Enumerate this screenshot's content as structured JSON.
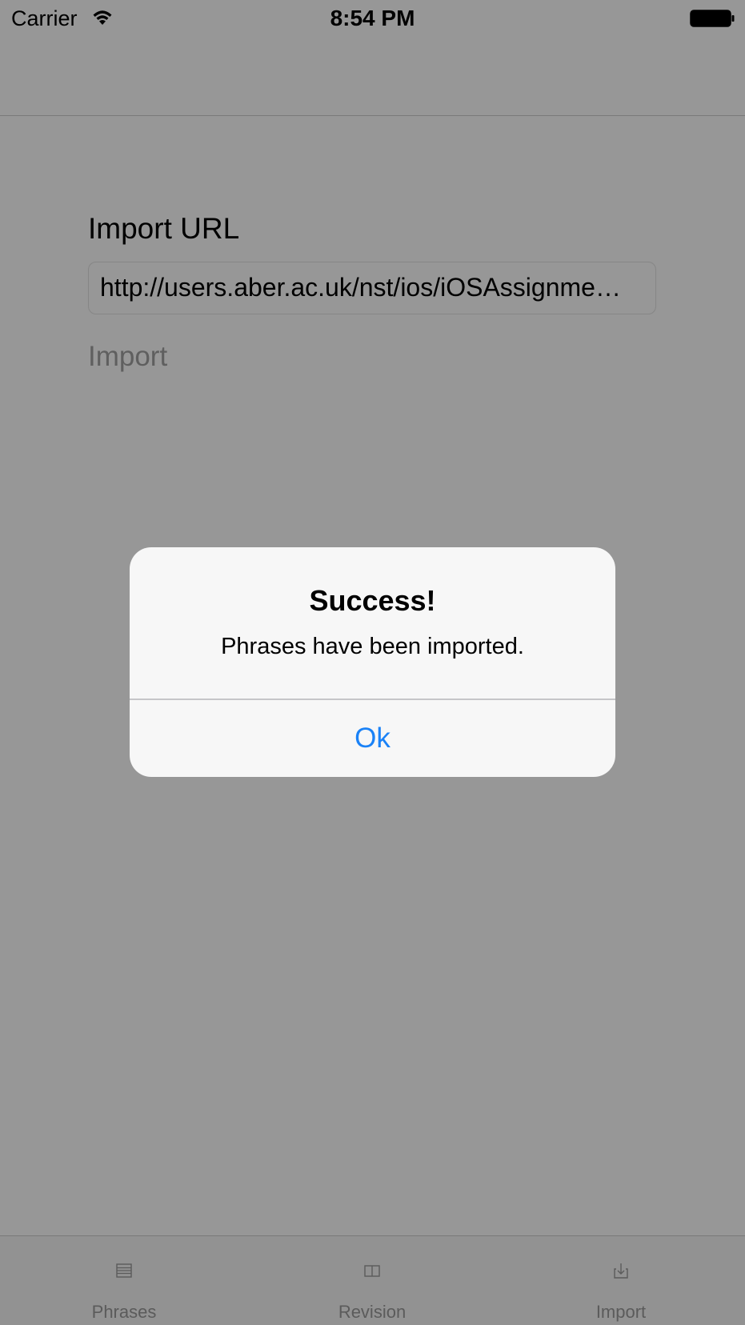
{
  "status_bar": {
    "carrier": "Carrier",
    "time": "8:54 PM",
    "wifi_icon": "wifi-icon",
    "battery_icon": "battery-icon"
  },
  "content": {
    "field_label": "Import URL",
    "url_value": "http://users.aber.ac.uk/nst/ios/iOSAssignme…",
    "import_button_label": "Import"
  },
  "alert": {
    "title": "Success!",
    "message": "Phrases have been imported.",
    "ok_label": "Ok",
    "ok_color": "#1a82f7"
  },
  "tab_bar": {
    "items": [
      {
        "label": "Phrases",
        "icon": "list-icon"
      },
      {
        "label": "Revision",
        "icon": "book-icon"
      },
      {
        "label": "Import",
        "icon": "download-icon"
      }
    ]
  },
  "colors": {
    "dimmed_background": "#979797",
    "alert_background": "#f7f7f7",
    "tab_label": "#5b5b5b"
  }
}
